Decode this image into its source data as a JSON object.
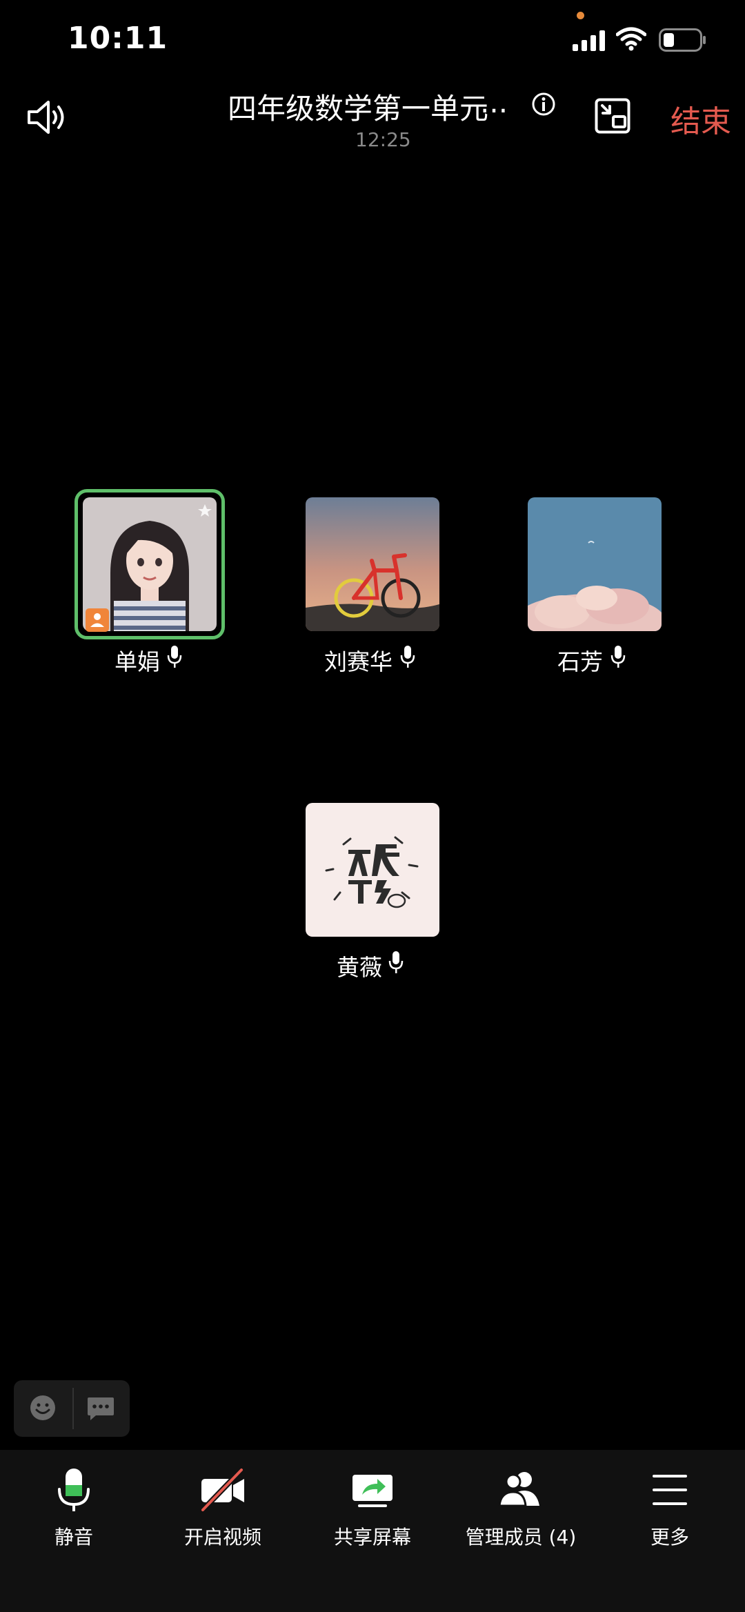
{
  "status_bar": {
    "time": "10:11"
  },
  "header": {
    "title": "四年级数学第一单元",
    "title_ellipsis": "...",
    "timer": "12:25",
    "end_label": "结束"
  },
  "participants": [
    {
      "name": "单娟",
      "mic": "microphone-icon",
      "active": true,
      "host": true
    },
    {
      "name": "刘赛华",
      "mic": "microphone-icon"
    },
    {
      "name": "石芳",
      "mic": "microphone-icon"
    },
    {
      "name": "黄薇",
      "mic": "microphone-icon"
    }
  ],
  "toolbar": {
    "mute": {
      "label": "静音",
      "icon": "microphone-icon"
    },
    "video": {
      "label": "开启视频",
      "icon": "video-off-icon"
    },
    "share": {
      "label": "共享屏幕",
      "icon": "share-screen-icon"
    },
    "members": {
      "label": "管理成员 (4)",
      "icon": "members-icon"
    },
    "more": {
      "label": "更多",
      "icon": "menu-icon"
    }
  },
  "colors": {
    "background": "#000000",
    "toolbar_bg": "#111111",
    "end_red": "#e45a4f",
    "active_green": "#5fbf6a",
    "mic_green": "#3fbf58",
    "muted_gray": "#8a8a8a"
  }
}
